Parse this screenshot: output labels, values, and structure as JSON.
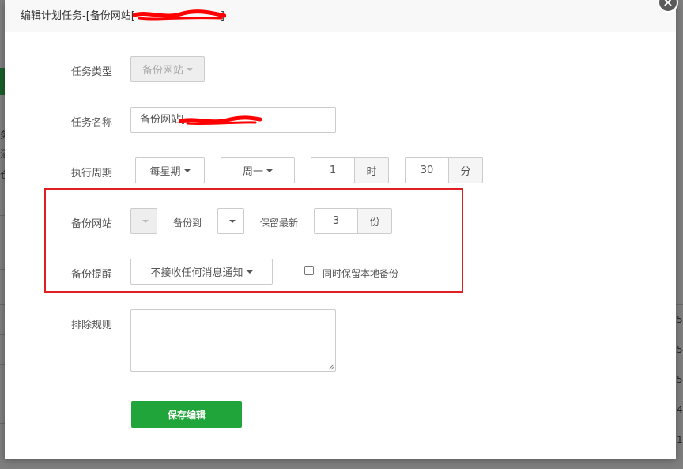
{
  "dialog": {
    "title": "编辑计划任务-[备份网站[",
    "title_suffix": "]",
    "close_symbol": "×"
  },
  "form": {
    "task_type": {
      "label": "任务类型",
      "value": "备份网站"
    },
    "task_name": {
      "label": "任务名称",
      "value": "备份网站["
    },
    "period": {
      "label": "执行周期",
      "type_value": "每星期",
      "weekday_value": "周一",
      "hour_value": "1",
      "hour_unit": "时",
      "minute_value": "30",
      "minute_unit": "分"
    },
    "backup": {
      "site_label": "备份网站",
      "site_value": "",
      "target_label": "备份到",
      "target_value": "",
      "keep_label": "保留最新",
      "keep_value": "3",
      "keep_unit": "份"
    },
    "notify": {
      "label": "备份提醒",
      "value": "不接收任何消息通知",
      "local_backup_label": "同时保留本地备份",
      "local_backup_checked": false
    },
    "exclude": {
      "label": "排除规则",
      "value": ""
    },
    "save_label": "保存编辑"
  },
  "background": {
    "left_fragments": [
      "务",
      "沼",
      "仓"
    ],
    "right_fragments": [
      ":5",
      ":5",
      ":5",
      ":4",
      ":1"
    ]
  },
  "colors": {
    "accent": "#20a53a",
    "highlight": "#e02020",
    "redaction": "#ff0000"
  }
}
